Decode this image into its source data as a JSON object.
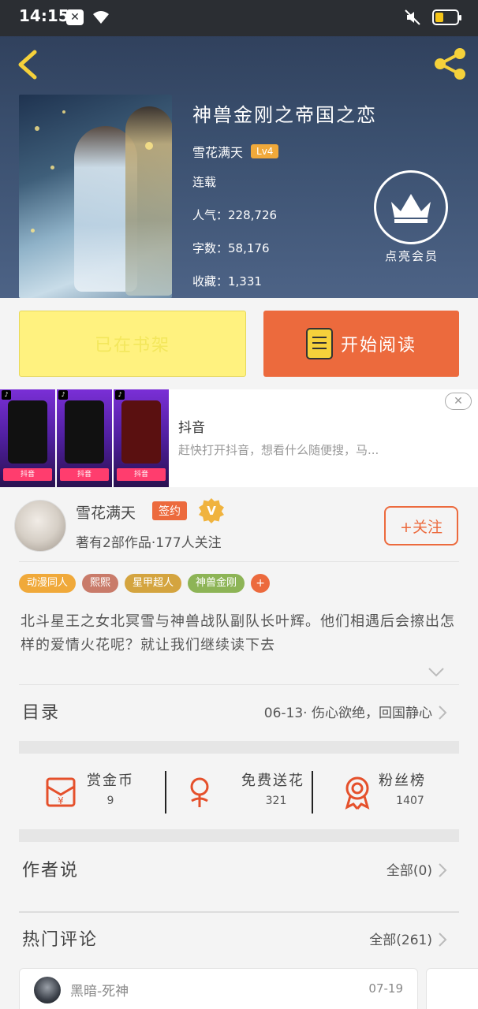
{
  "status_bar": {
    "time": "14:15"
  },
  "book": {
    "title": "神兽金刚之帝国之恋",
    "author": "雪花满天",
    "level": "Lv4",
    "status": "连载",
    "popularity": "人气：228,726",
    "word_count": "字数：58,176",
    "collections": "收藏：1,331"
  },
  "vip": {
    "label": "点亮会员"
  },
  "actions": {
    "shelf_label": "已在书架",
    "read_label": "开始阅读"
  },
  "ad": {
    "thumb_tag": "抖音",
    "title": "抖音",
    "description": "赶快打开抖音，想看什么随便搜，马...",
    "close": "✕"
  },
  "author_info": {
    "name": "雪花满天",
    "sign_badge": "签约",
    "v_badge": "V",
    "stats": "著有2部作品·177人关注",
    "follow_label": "+关注"
  },
  "tags": [
    {
      "label": "动漫同人",
      "color": "#f0a93a"
    },
    {
      "label": "熙熙",
      "color": "#c97b6a"
    },
    {
      "label": "星甲超人",
      "color": "#d4a43f"
    },
    {
      "label": "神兽金刚",
      "color": "#8db456"
    }
  ],
  "tag_more": "+",
  "synopsis": "北斗星王之女北冥雪与神兽战队副队长叶辉。他们相遇后会擦出怎样的爱情火花呢？就让我们继续读下去",
  "catalog": {
    "title": "目录",
    "latest": "06-13· 伤心欲绝，回国静心"
  },
  "rewards": [
    {
      "label": "赏金币",
      "count": "9"
    },
    {
      "label": "免费送花",
      "count": "321"
    },
    {
      "label": "粉丝榜",
      "count": "1407"
    }
  ],
  "author_says": {
    "title": "作者说",
    "all": "全部(0)"
  },
  "hot_comments": {
    "title": "热门评论",
    "all": "全部(261)"
  },
  "comment": {
    "user": "黑暗-死神",
    "date": "07-19"
  },
  "colors": {
    "accent": "#ec6a3d",
    "shelf_yellow": "#fff27f",
    "level_orange": "#f0a93a"
  }
}
